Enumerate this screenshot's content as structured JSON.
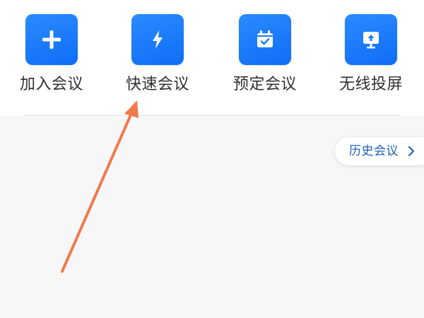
{
  "actions": [
    {
      "label": "加入会议",
      "icon": "plus-icon"
    },
    {
      "label": "快速会议",
      "icon": "lightning-icon"
    },
    {
      "label": "预定会议",
      "icon": "calendar-check-icon"
    },
    {
      "label": "无线投屏",
      "icon": "screen-cast-icon"
    }
  ],
  "history": {
    "label": "历史会议",
    "icon": "chevron-right-icon"
  },
  "colors": {
    "tile_gradient_start": "#2b8bff",
    "tile_gradient_end": "#0f6df5",
    "history_text": "#1f5fb7",
    "arrow": "#f07a4c",
    "background": "#f7f7f8"
  }
}
